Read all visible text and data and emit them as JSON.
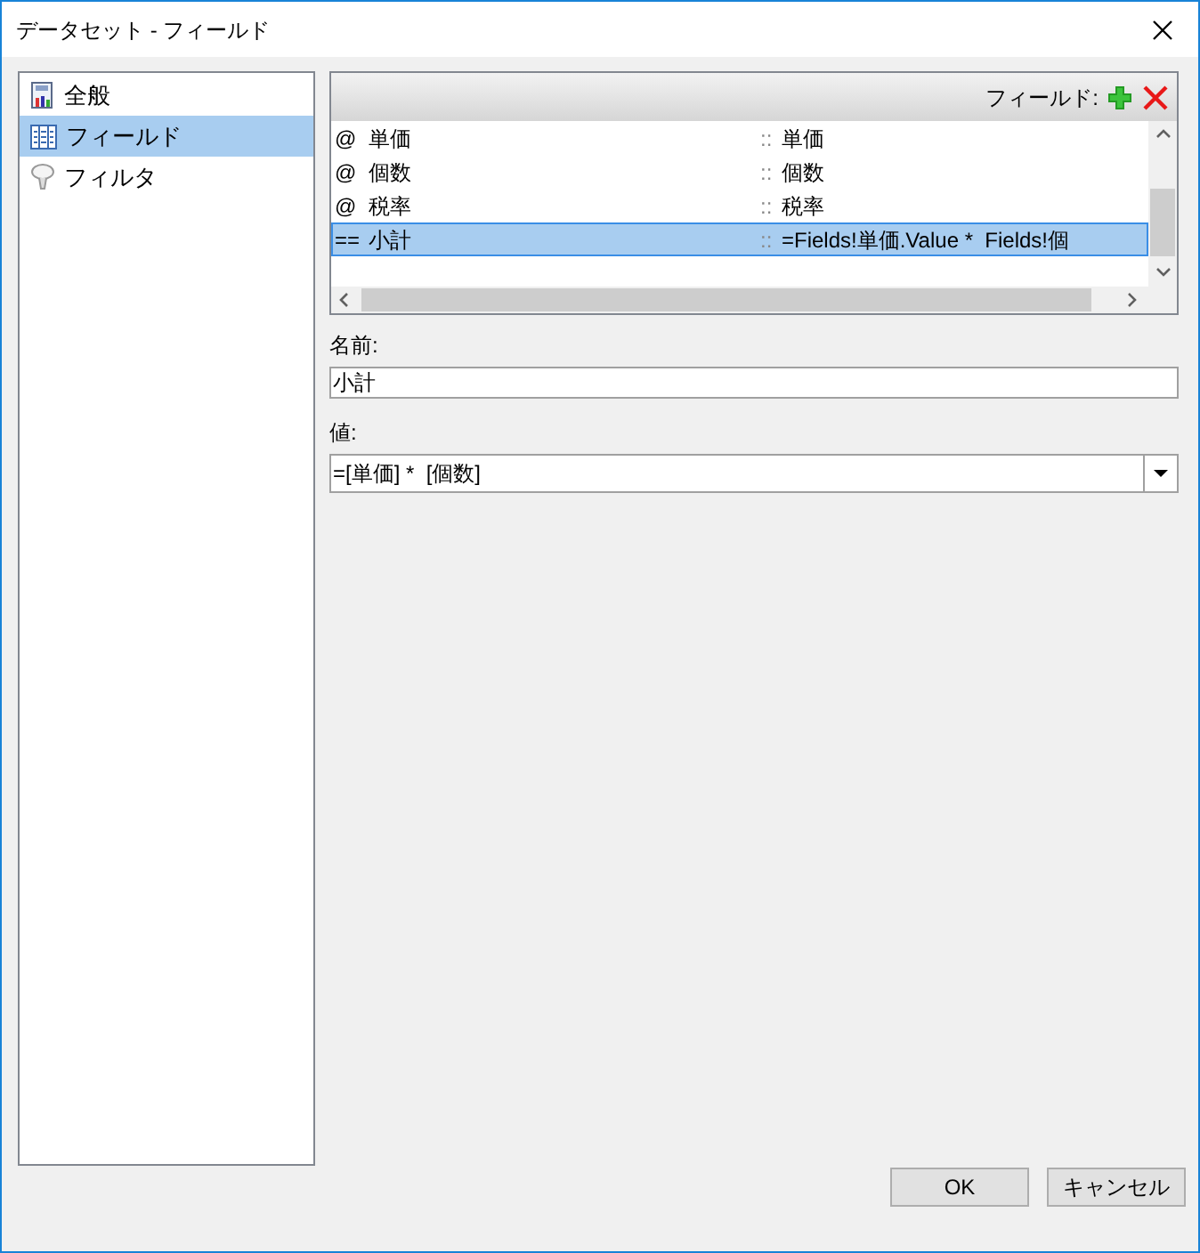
{
  "window": {
    "title": "データセット - フィールド"
  },
  "sidebar": {
    "items": [
      {
        "label": "全般",
        "kind": "general",
        "selected": false
      },
      {
        "label": "フィールド",
        "kind": "fields",
        "selected": true
      },
      {
        "label": "フィルタ",
        "kind": "filter",
        "selected": false
      }
    ]
  },
  "fields_grid": {
    "label": "フィールド:",
    "rows": [
      {
        "marker": "@",
        "name": "単価",
        "separator": "::",
        "value": "単価",
        "selected": false
      },
      {
        "marker": "@",
        "name": "個数",
        "separator": "::",
        "value": "個数",
        "selected": false
      },
      {
        "marker": "@",
        "name": "税率",
        "separator": "::",
        "value": "税率",
        "selected": false
      },
      {
        "marker": "==",
        "name": "小計",
        "separator": "::",
        "value": "=Fields!単価.Value *  Fields!個",
        "selected": true
      }
    ]
  },
  "name_field": {
    "label": "名前:",
    "value": "小計"
  },
  "value_field": {
    "label": "値:",
    "value": "=[単価] *  [個数]"
  },
  "buttons": [
    "OK",
    "キャンセル"
  ]
}
